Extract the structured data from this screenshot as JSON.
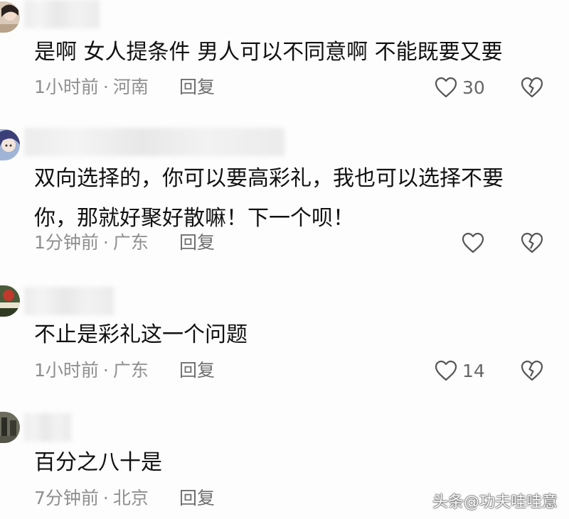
{
  "comments": [
    {
      "text_lines": [
        "是啊  女人提条件  男人可以不同意啊  不能既要又要"
      ],
      "time": "1小时前",
      "location": "河南",
      "reply_label": "回复",
      "likes": "30"
    },
    {
      "text_lines": [
        "双向选择的，你可以要高彩礼，我也可以选择不要",
        "你，那就好聚好散嘛！下一个呗！"
      ],
      "time": "1分钟前",
      "location": "广东",
      "reply_label": "回复",
      "likes": ""
    },
    {
      "text_lines": [
        "不止是彩礼这一个问题"
      ],
      "time": "1小时前",
      "location": "广东",
      "reply_label": "回复",
      "likes": "14"
    },
    {
      "text_lines": [
        "百分之八十是"
      ],
      "time": "7分钟前",
      "location": "北京",
      "reply_label": "回复",
      "likes": ""
    }
  ],
  "separator": "·",
  "watermark": "头条@功夫哇哇意",
  "icons": {
    "like": "heart-outline-icon",
    "dislike": "broken-heart-icon"
  },
  "colors": {
    "text": "#111111",
    "meta": "#8f8f8f",
    "icon": "#555555"
  }
}
